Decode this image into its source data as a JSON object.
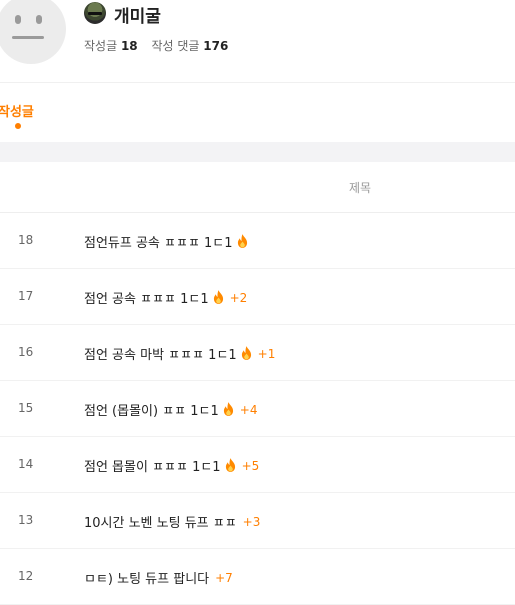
{
  "profile": {
    "nickname": "개미굴",
    "posts_label": "작성글",
    "posts_count": "18",
    "comments_label": "작성 댓글",
    "comments_count": "176"
  },
  "tabs": [
    {
      "label": "작성글",
      "active": true
    }
  ],
  "table": {
    "title_header": "제목",
    "rows": [
      {
        "num": "18",
        "title": "점언듀프 공속 ㅍㅍㅍ 1ㄷ1",
        "hot": true,
        "comments": ""
      },
      {
        "num": "17",
        "title": "점언 공속 ㅍㅍㅍ 1ㄷ1",
        "hot": true,
        "comments": "+2"
      },
      {
        "num": "16",
        "title": "점언 공속 마박 ㅍㅍㅍ 1ㄷ1",
        "hot": true,
        "comments": "+1"
      },
      {
        "num": "15",
        "title": "점언 (몹몰이) ㅍㅍ 1ㄷ1",
        "hot": true,
        "comments": "+4"
      },
      {
        "num": "14",
        "title": "점언 몹몰이 ㅍㅍㅍ 1ㄷ1",
        "hot": true,
        "comments": "+5"
      },
      {
        "num": "13",
        "title": "10시간 노벤 노팅 듀프 ㅍㅍ",
        "hot": false,
        "comments": "+3"
      },
      {
        "num": "12",
        "title": "ㅁㅌ) 노팅 듀프 팝니다",
        "hot": false,
        "comments": "+7"
      }
    ]
  },
  "colors": {
    "accent": "#ff7f00",
    "fire": "#ff8a00"
  },
  "icons": {
    "hot": "fire-icon",
    "avatar": "default-avatar-face",
    "badge": "soldier-badge-icon"
  }
}
